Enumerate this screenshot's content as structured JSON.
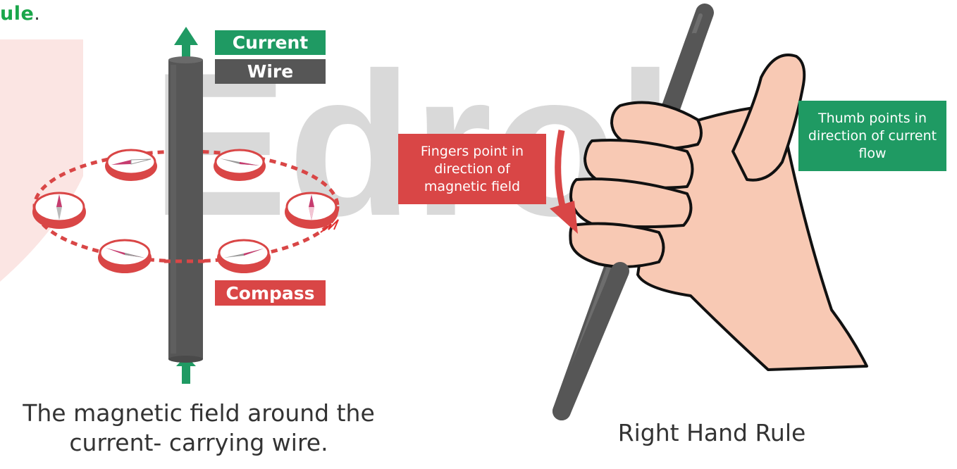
{
  "header_fragment": {
    "text": "ule",
    "period": "."
  },
  "watermark": {
    "text": "Edrol"
  },
  "left_figure": {
    "labels": {
      "current": "Current",
      "wire": "Wire",
      "compass": "Compass"
    },
    "caption_line1": "The magnetic field around the",
    "caption_line2": "current- carrying wire."
  },
  "right_figure": {
    "fingers_text": "Fingers point in direction of magnetic field",
    "thumb_text": "Thumb points in direction of current flow",
    "caption": "Right Hand Rule"
  },
  "colors": {
    "green": "#1f9a63",
    "red": "#d94646",
    "wire": "#565656",
    "skin": "#f8c9b4",
    "bright_green": "#1aa64a"
  }
}
